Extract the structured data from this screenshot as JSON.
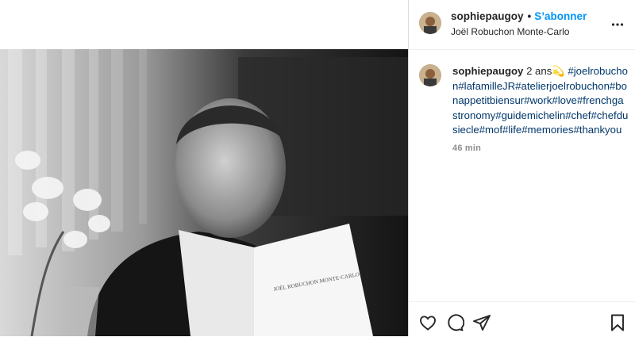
{
  "post": {
    "username": "sophiepaugoy",
    "separator": "•",
    "follow_label": "S’abonner",
    "location": "Joël Robuchon Monte-Carlo"
  },
  "caption": {
    "username": "sophiepaugoy",
    "text": "2 ans💫",
    "hashtags": "#joelrobuchon#lafamilleJR#atelierjoelrobuchon#bonappetitbiensur#work#love#frenchgastronomy#guidemichelin#chef#chefdusiecle#mof#life#memories#thankyou",
    "time": "46 min"
  },
  "photo": {
    "menu_text": "JOËL ROBUCHON MONTE-CARLO"
  },
  "icons": {
    "more": "more-options-icon",
    "like": "heart-icon",
    "comment": "comment-icon",
    "share": "share-icon",
    "save": "bookmark-icon"
  },
  "colors": {
    "follow": "#0095f6",
    "hashtag": "#00376b",
    "text": "#262626",
    "muted": "#8e8e8e"
  }
}
